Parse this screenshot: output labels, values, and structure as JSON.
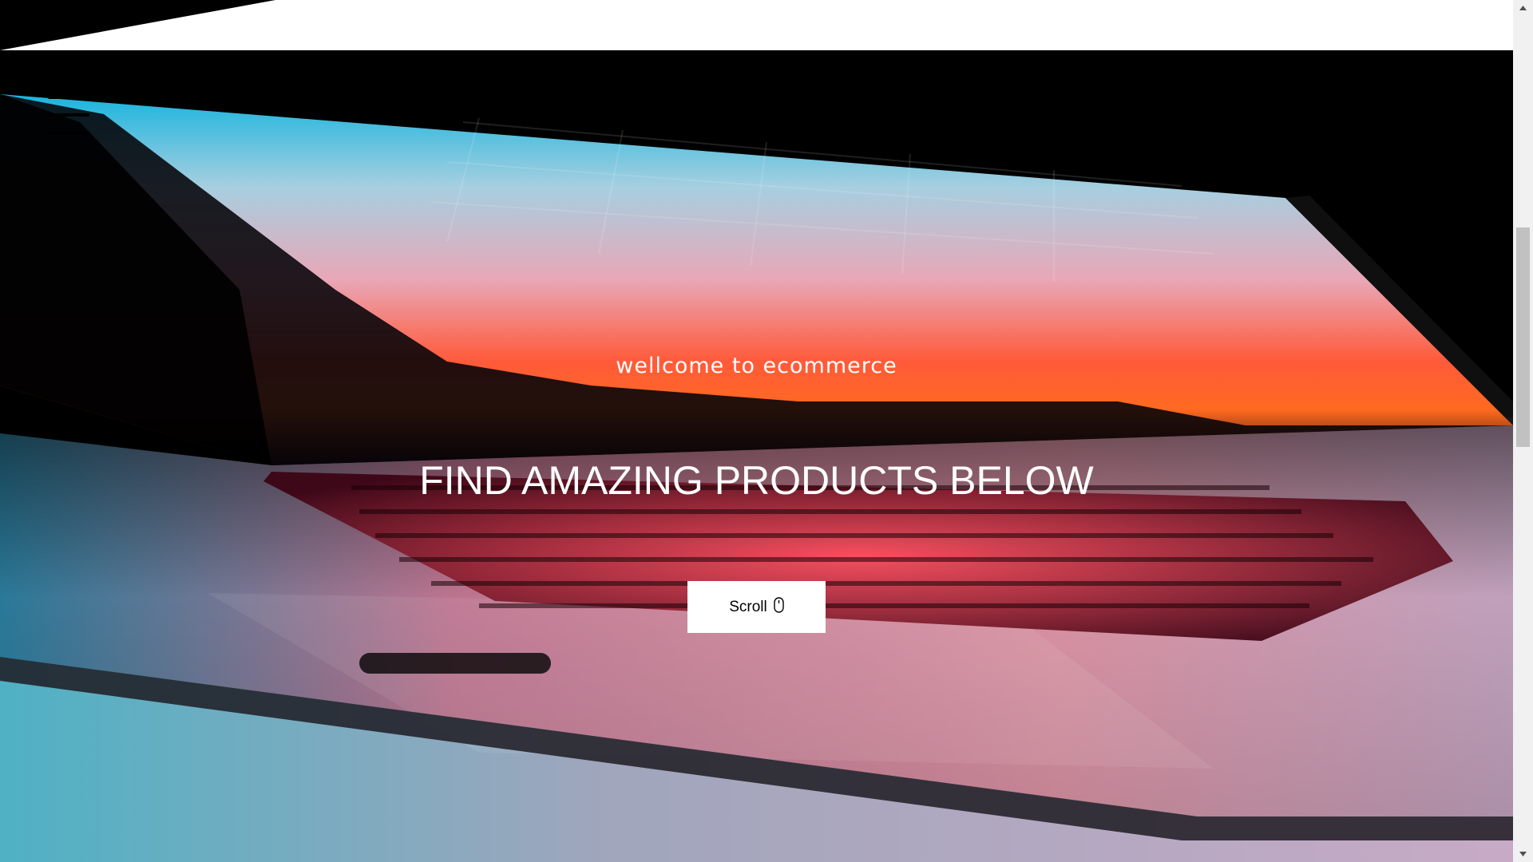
{
  "hero": {
    "subtitle": "wellcome to ecommerce",
    "title": "FIND AMAZING PRODUCTS BELOW",
    "background_image": "laptop-open-sunset-screen"
  },
  "nav": {
    "menu_icon": "hamburger-menu-icon"
  },
  "scroll_button": {
    "label": "Scroll",
    "icon": "mouse-icon"
  },
  "colors": {
    "page_background": "#ffffff",
    "hero_text": "#ffffff",
    "button_background": "#ffffff",
    "button_text": "#000000",
    "scrollbar_track": "#f1f1f1",
    "scrollbar_thumb": "#c1c1c1"
  }
}
